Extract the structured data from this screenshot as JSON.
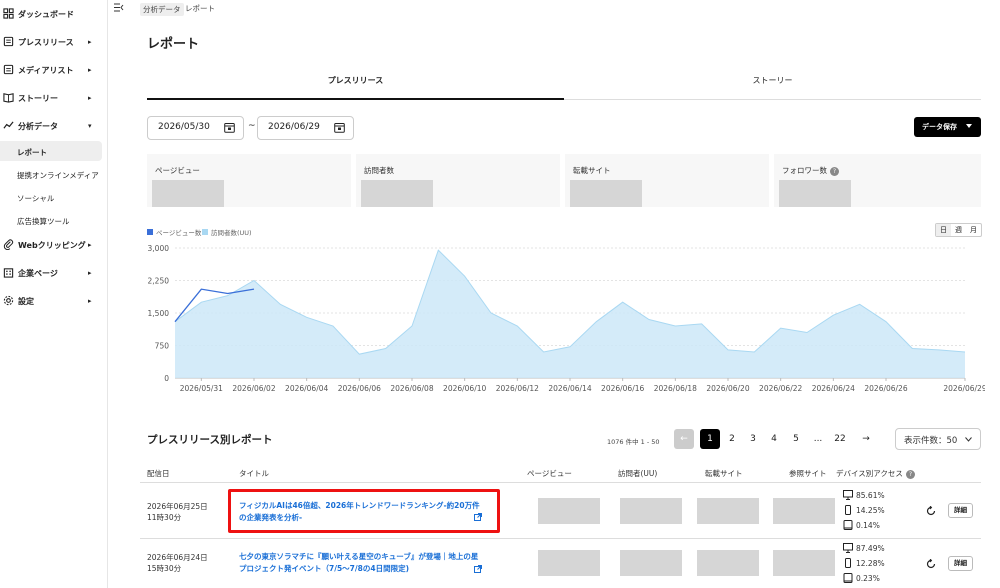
{
  "sidebar": {
    "items": [
      {
        "label": "ダッシュボード",
        "icon": "grid-icon",
        "chevron": ""
      },
      {
        "label": "プレスリリース",
        "icon": "document-icon",
        "chevron": "▸"
      },
      {
        "label": "メディアリスト",
        "icon": "list-icon",
        "chevron": "▸"
      },
      {
        "label": "ストーリー",
        "icon": "book-icon",
        "chevron": "▸"
      },
      {
        "label": "分析データ",
        "icon": "chart-icon",
        "chevron": "▾"
      },
      {
        "label": "Webクリッピング",
        "icon": "clip-icon",
        "chevron": "▸"
      },
      {
        "label": "企業ページ",
        "icon": "building-icon",
        "chevron": "▸"
      },
      {
        "label": "設定",
        "icon": "gear-icon",
        "chevron": "▸"
      }
    ],
    "sub_items": [
      {
        "label": "レポート",
        "active": true
      },
      {
        "label": "提携オンラインメディア",
        "active": false
      },
      {
        "label": "ソーシャル",
        "active": false
      },
      {
        "label": "広告換算ツール",
        "active": false
      }
    ]
  },
  "breadcrumb": {
    "parent": "分析データ",
    "current": "レポート"
  },
  "page_title": "レポート",
  "tabs": [
    {
      "label": "プレスリリース",
      "active": true
    },
    {
      "label": "ストーリー",
      "active": false
    }
  ],
  "date_range": {
    "start": "2026/05/30",
    "separator": "~",
    "end": "2026/06/29"
  },
  "save_button": "データ保存",
  "metrics": [
    {
      "label": "ページビュー",
      "help": false
    },
    {
      "label": "訪問者数",
      "help": false
    },
    {
      "label": "転載サイト",
      "help": false
    },
    {
      "label": "フォロワー数",
      "help": true,
      "help_mark": "?"
    }
  ],
  "legend": {
    "pv": "ページビュー数",
    "uu": "訪問者数(UU)"
  },
  "period_buttons": [
    "日",
    "週",
    "月"
  ],
  "colors": {
    "pv_line": "#3a6fd8",
    "uu_fill": "#cde8f8",
    "uu_line": "#a9d8f2",
    "highlight": "#e11111",
    "link": "#1a6fd6"
  },
  "chart_data": {
    "type": "area",
    "x": [
      "2026/05/30",
      "2026/05/31",
      "2026/06/01",
      "2026/06/02",
      "2026/06/03",
      "2026/06/04",
      "2026/06/05",
      "2026/06/06",
      "2026/06/07",
      "2026/06/08",
      "2026/06/09",
      "2026/06/10",
      "2026/06/11",
      "2026/06/12",
      "2026/06/13",
      "2026/06/14",
      "2026/06/15",
      "2026/06/16",
      "2026/06/17",
      "2026/06/18",
      "2026/06/19",
      "2026/06/20",
      "2026/06/21",
      "2026/06/22",
      "2026/06/23",
      "2026/06/24",
      "2026/06/25",
      "2026/06/26",
      "2026/06/27",
      "2026/06/28",
      "2026/06/29"
    ],
    "x_tick_labels": [
      "2026/05/31",
      "2026/06/02",
      "2026/06/04",
      "2026/06/06",
      "2026/06/08",
      "2026/06/10",
      "2026/06/12",
      "2026/06/14",
      "2026/06/16",
      "2026/06/18",
      "2026/06/20",
      "2026/06/22",
      "2026/06/24",
      "2026/06/26",
      "2026/06/29"
    ],
    "y_ticks": [
      "3,000",
      "2,250",
      "1,500",
      "750",
      "0"
    ],
    "ylim": [
      0,
      3000
    ],
    "grid": true,
    "legend_position": "top-left",
    "series": [
      {
        "name": "訪問者数(UU)",
        "values": [
          1300,
          1750,
          1900,
          2250,
          1700,
          1400,
          1200,
          550,
          680,
          1200,
          2950,
          2350,
          1500,
          1200,
          600,
          720,
          1300,
          1750,
          1350,
          1200,
          1250,
          650,
          600,
          1150,
          1050,
          1450,
          1700,
          1300,
          680,
          650,
          600
        ]
      },
      {
        "name": "ページビュー数",
        "values": [
          1300,
          2050,
          1950,
          2050
        ]
      }
    ]
  },
  "table_section": {
    "title": "プレスリリース別レポート",
    "count_text": "1076 件中 1 - 50",
    "pages": [
      "1",
      "2",
      "3",
      "4",
      "5",
      "...",
      "22"
    ],
    "prev_arrow": "←",
    "next_arrow": "→",
    "per_page": "表示件数：50",
    "columns": [
      "配信日",
      "タイトル",
      "ページビュー",
      "訪問者(UU)",
      "転載サイト",
      "参照サイト",
      "デバイス別アクセス"
    ],
    "rows": [
      {
        "date": "2026年06月25日",
        "time": "11時30分",
        "title": "フィジカルAIは46倍超、2026年トレンドワードランキング-約20万件の企業発表を分析-",
        "desktop": "85.61%",
        "mobile": "14.25%",
        "tablet": "0.14%",
        "detail": "詳細"
      },
      {
        "date": "2026年06月24日",
        "time": "15時30分",
        "title": "七夕の東京ソラマチに『願い叶える星空のキューブ』が登場｜地上の星プロジェクト発イベント（7/5〜7/8の4日間限定)",
        "desktop": "87.49%",
        "mobile": "12.28%",
        "tablet": "0.23%",
        "detail": "詳細"
      }
    ]
  }
}
